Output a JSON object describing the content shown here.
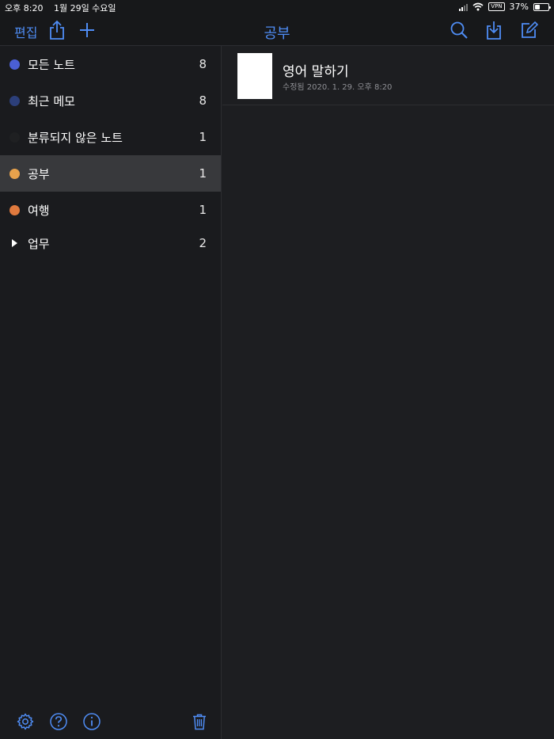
{
  "status_bar": {
    "time": "오후 8:20",
    "date": "1월 29일 수요일",
    "vpn": "VPN",
    "battery_text": "37%",
    "battery_level": 0.37
  },
  "nav": {
    "edit_label": "편집",
    "title": "공부"
  },
  "sidebar": {
    "folders": [
      {
        "label": "모든 노트",
        "count": "8",
        "color": "#4a5fd4"
      },
      {
        "label": "최근 메모",
        "count": "8",
        "color": "#2c3f7a"
      },
      {
        "label": "분류되지 않은 노트",
        "count": "1",
        "color": "#1f2022"
      },
      {
        "label": "공부",
        "count": "1",
        "color": "#e8a24c"
      },
      {
        "label": "여행",
        "count": "1",
        "color": "#e07a3e"
      },
      {
        "label": "업무",
        "count": "2"
      }
    ]
  },
  "notes": [
    {
      "title": "영어 말하기",
      "modified": "수정됨 2020. 1. 29. 오후 8:20"
    }
  ],
  "colors": {
    "accent": "#4f8df5",
    "selected_row": "#38393c"
  }
}
